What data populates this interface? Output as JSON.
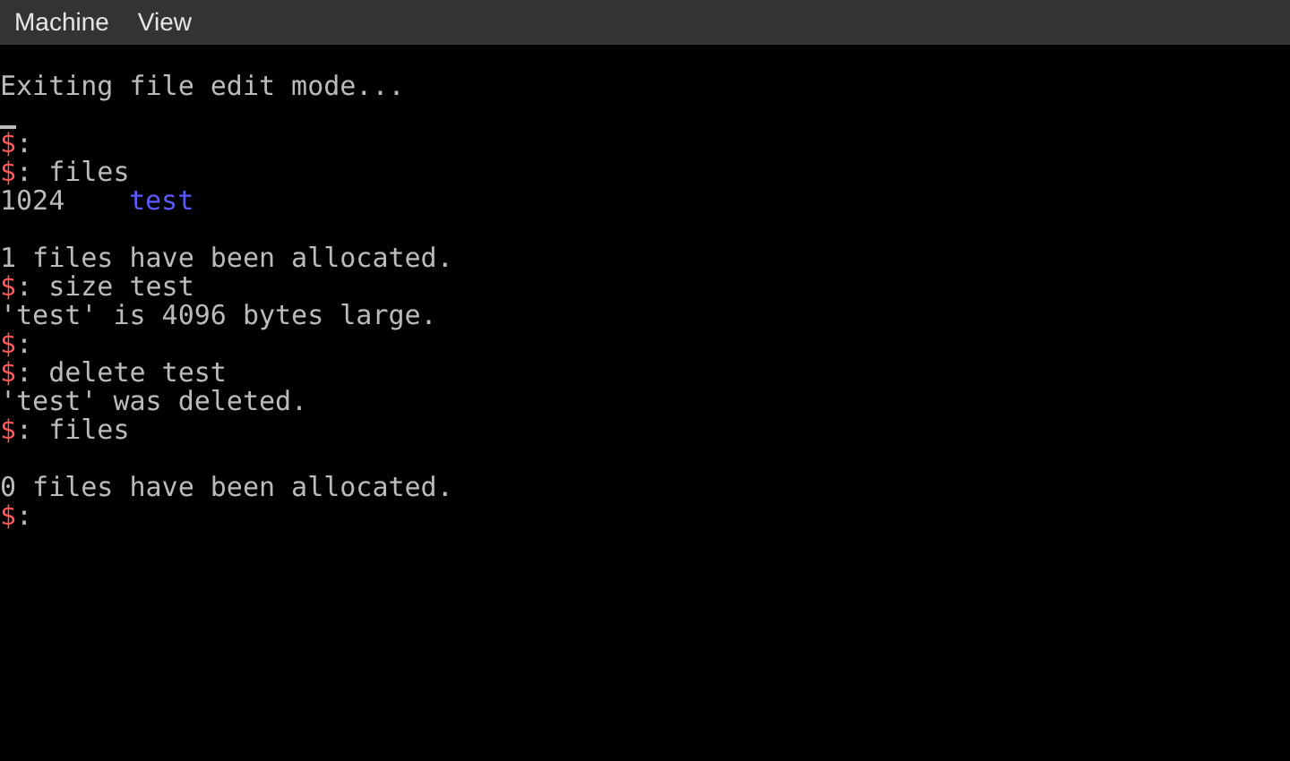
{
  "menu_bar": [
    {
      "label": "Machine"
    },
    {
      "label": "View"
    }
  ],
  "terminal": {
    "lines": [
      {
        "kind": "output",
        "text": "Exiting file edit mode..."
      },
      {
        "kind": "cursor"
      },
      {
        "kind": "prompt",
        "prompt": "$",
        "text": ":"
      },
      {
        "kind": "prompt",
        "prompt": "$",
        "text": ": files"
      },
      {
        "kind": "listing",
        "size": "1024",
        "name": "test"
      },
      {
        "kind": "blank"
      },
      {
        "kind": "output",
        "text": "1 files have been allocated."
      },
      {
        "kind": "prompt",
        "prompt": "$",
        "text": ": size test"
      },
      {
        "kind": "output",
        "text": "'test' is 4096 bytes large."
      },
      {
        "kind": "prompt",
        "prompt": "$",
        "text": ":"
      },
      {
        "kind": "prompt",
        "prompt": "$",
        "text": ": delete test"
      },
      {
        "kind": "output",
        "text": "'test' was deleted."
      },
      {
        "kind": "prompt",
        "prompt": "$",
        "text": ": files"
      },
      {
        "kind": "blank"
      },
      {
        "kind": "output",
        "text": "0 files have been allocated."
      },
      {
        "kind": "prompt",
        "prompt": "$",
        "text": ":"
      }
    ]
  }
}
